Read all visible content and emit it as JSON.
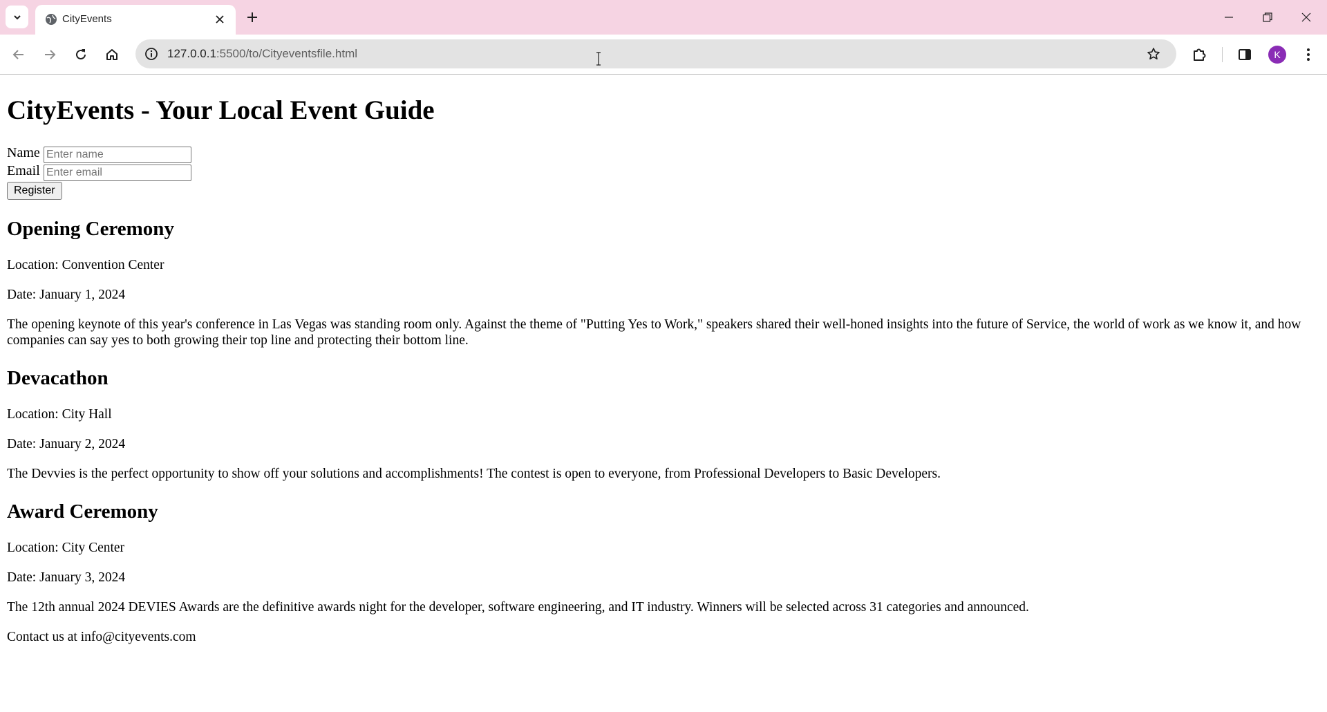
{
  "browser": {
    "tab_title": "CityEvents",
    "url_host": "127.0.0.1",
    "url_rest": ":5500/to/Cityeventsfile.html",
    "profile_initial": "K"
  },
  "page": {
    "heading": "CityEvents - Your Local Event Guide",
    "form": {
      "name_label": "Name",
      "name_placeholder": "Enter name",
      "email_label": "Email",
      "email_placeholder": "Enter email",
      "register_label": "Register"
    },
    "events": [
      {
        "title": "Opening Ceremony",
        "location": "Location: Convention Center",
        "date": "Date: January 1, 2024",
        "description": "The opening keynote of this year's conference in Las Vegas was standing room only. Against the theme of \"Putting Yes to Work,\" speakers shared their well-honed insights into the future of Service, the world of work as we know it, and how companies can say yes to both growing their top line and protecting their bottom line."
      },
      {
        "title": "Devacathon",
        "location": "Location: City Hall",
        "date": "Date: January 2, 2024",
        "description": "The Devvies is the perfect opportunity to show off your solutions and accomplishments! The contest is open to everyone, from Professional Developers to Basic Developers."
      },
      {
        "title": "Award Ceremony",
        "location": "Location: City Center",
        "date": "Date: January 3, 2024",
        "description": "The 12th annual 2024 DEVIES Awards are the definitive awards night for the developer, software engineering, and IT industry. Winners will be selected across 31 categories and announced."
      }
    ],
    "footer": "Contact us at info@cityevents.com"
  }
}
